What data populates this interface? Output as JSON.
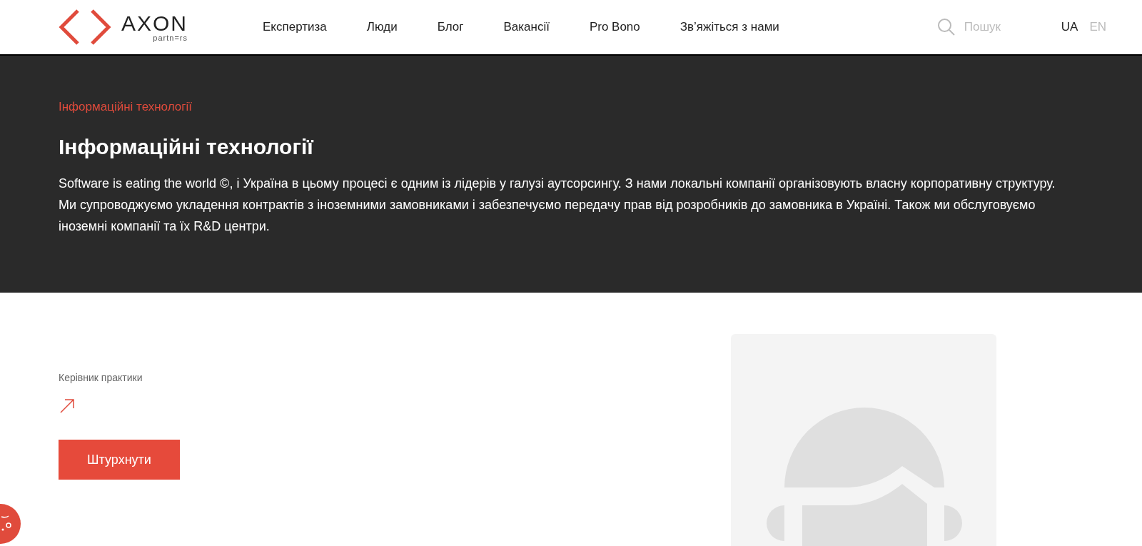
{
  "header": {
    "logo": {
      "wordmark": "AXON",
      "tagline": "partn=rs"
    },
    "nav": [
      {
        "label": "Експертиза"
      },
      {
        "label": "Люди"
      },
      {
        "label": "Блог"
      },
      {
        "label": "Вакансії"
      },
      {
        "label": "Pro Bono"
      },
      {
        "label": "Зв’яжіться з нами"
      }
    ],
    "search": {
      "placeholder": "Пошук"
    },
    "languages": [
      {
        "label": "UA",
        "selected": true
      },
      {
        "label": "EN",
        "selected": false
      }
    ]
  },
  "hero": {
    "breadcrumb": "Інформаційні технології",
    "title": "Інформаційні технології",
    "description": "Software is eating the world ©, і Україна в цьому процесі є одним із лідерів у галузі аутсорсингу. З нами локальні компанії організовують власну корпоративну структуру. Ми супроводжуємо укладення контрактів з іноземними замовниками і забезпечуємо передачу прав від розробників до замовника в Україні. Також ми обслуговуємо іноземні компанії та їх R&D центри."
  },
  "practice_head": {
    "label": "Керівник практики",
    "button": "Штурхнути"
  }
}
